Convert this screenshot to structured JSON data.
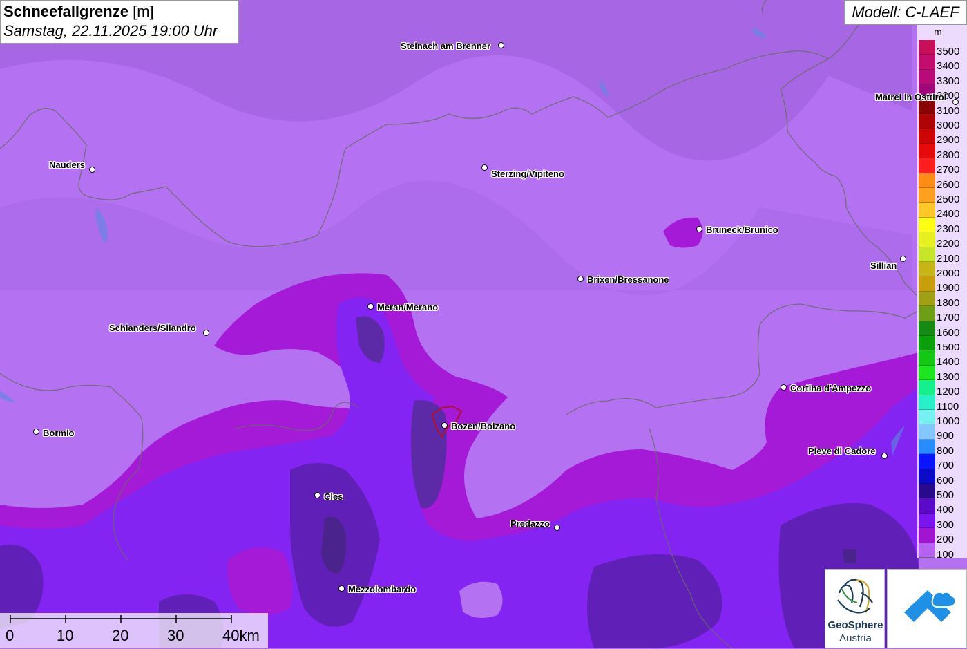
{
  "title": {
    "parameter": "Schneefallgrenze",
    "unit": "[m]",
    "datetime": "Samstag, 22.11.2025 19:00 Uhr"
  },
  "model": "Modell: C-LAEF",
  "legend": {
    "unit": "m",
    "entries": [
      {
        "label": "3500",
        "color": "#c8105a"
      },
      {
        "label": "3400",
        "color": "#c20c6e"
      },
      {
        "label": "3300",
        "color": "#b80a78"
      },
      {
        "label": "3200",
        "color": "#a0067a"
      },
      {
        "label": "3100",
        "color": "#8a0202"
      },
      {
        "label": "3000",
        "color": "#b00404"
      },
      {
        "label": "2900",
        "color": "#cc0606"
      },
      {
        "label": "2800",
        "color": "#e60a0a"
      },
      {
        "label": "2700",
        "color": "#ff1e1e"
      },
      {
        "label": "2600",
        "color": "#ff8c14"
      },
      {
        "label": "2500",
        "color": "#ffa01e"
      },
      {
        "label": "2400",
        "color": "#ffc828"
      },
      {
        "label": "2300",
        "color": "#ffff14"
      },
      {
        "label": "2200",
        "color": "#e6f01e"
      },
      {
        "label": "2100",
        "color": "#c8e628"
      },
      {
        "label": "2000",
        "color": "#c8b414"
      },
      {
        "label": "1900",
        "color": "#c89e0a"
      },
      {
        "label": "1800",
        "color": "#a0a014"
      },
      {
        "label": "1700",
        "color": "#6e9e14"
      },
      {
        "label": "1600",
        "color": "#148c14"
      },
      {
        "label": "1500",
        "color": "#0aa00a"
      },
      {
        "label": "1400",
        "color": "#14c814"
      },
      {
        "label": "1300",
        "color": "#1ee61e"
      },
      {
        "label": "1200",
        "color": "#14f08c"
      },
      {
        "label": "1100",
        "color": "#28f0c8"
      },
      {
        "label": "1000",
        "color": "#78f0f0"
      },
      {
        "label": "900",
        "color": "#82c8ff"
      },
      {
        "label": "800",
        "color": "#288cff"
      },
      {
        "label": "700",
        "color": "#0a14ff"
      },
      {
        "label": "600",
        "color": "#0a0ac8"
      },
      {
        "label": "500",
        "color": "#2a0a8c"
      },
      {
        "label": "400",
        "color": "#5a0ac8"
      },
      {
        "label": "300",
        "color": "#7a14f0"
      },
      {
        "label": "200",
        "color": "#a014d2"
      },
      {
        "label": "100",
        "color": "#b464f0"
      }
    ]
  },
  "cities": [
    {
      "name": "Steinach am Brenner",
      "id": "steinach"
    },
    {
      "name": "Matrei in Osttirol",
      "id": "matrei"
    },
    {
      "name": "Nauders",
      "id": "nauders"
    },
    {
      "name": "Sterzing/Vipiteno",
      "id": "sterzing"
    },
    {
      "name": "Bruneck/Brunico",
      "id": "bruneck"
    },
    {
      "name": "Sillian",
      "id": "sillian"
    },
    {
      "name": "Brixen/Bressanone",
      "id": "brixen"
    },
    {
      "name": "Meran/Merano",
      "id": "meran"
    },
    {
      "name": "Schlanders/Silandro",
      "id": "schlanders"
    },
    {
      "name": "Cortina d'Ampezzo",
      "id": "cortina"
    },
    {
      "name": "Bormio",
      "id": "bormio"
    },
    {
      "name": "Bozen/Bolzano",
      "id": "bozen"
    },
    {
      "name": "Pieve di Cadore",
      "id": "pieve"
    },
    {
      "name": "Cles",
      "id": "cles"
    },
    {
      "name": "Predazzo",
      "id": "predazzo"
    },
    {
      "name": "Mezzolombardo",
      "id": "mezzolombardo"
    }
  ],
  "scale_bar": {
    "labels": [
      "0",
      "10",
      "20",
      "30",
      "40km"
    ]
  },
  "logos": {
    "geosphere_line1": "GeoSphere",
    "geosphere_line2": "Austria"
  }
}
